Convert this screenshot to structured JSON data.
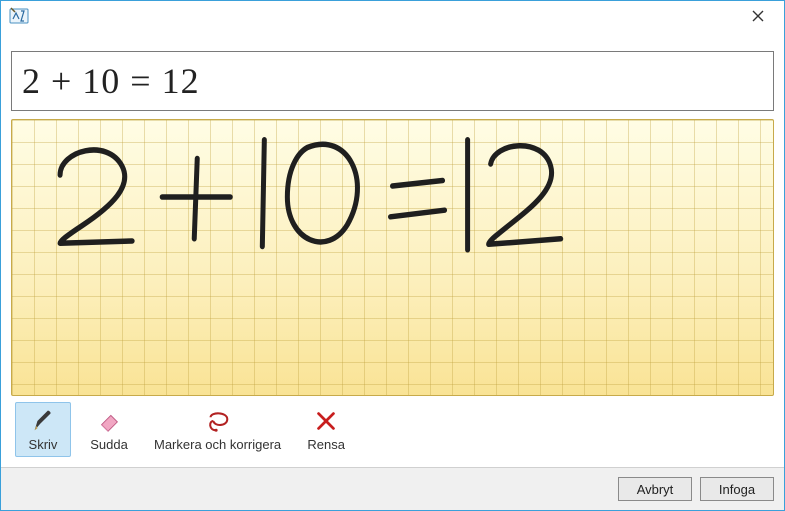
{
  "titlebar": {
    "close_label": "×"
  },
  "formula": {
    "rendered": "2 + 10 = 12"
  },
  "handwriting": {
    "expression": "2 + 10 = 12"
  },
  "toolbar": {
    "write": "Skriv",
    "erase": "Sudda",
    "select_correct": "Markera och korrigera",
    "clear": "Rensa",
    "active": "write"
  },
  "footer": {
    "cancel": "Avbryt",
    "insert": "Infoga"
  },
  "colors": {
    "window_border": "#3aa0da",
    "ink_stroke": "#1f1f1f"
  }
}
